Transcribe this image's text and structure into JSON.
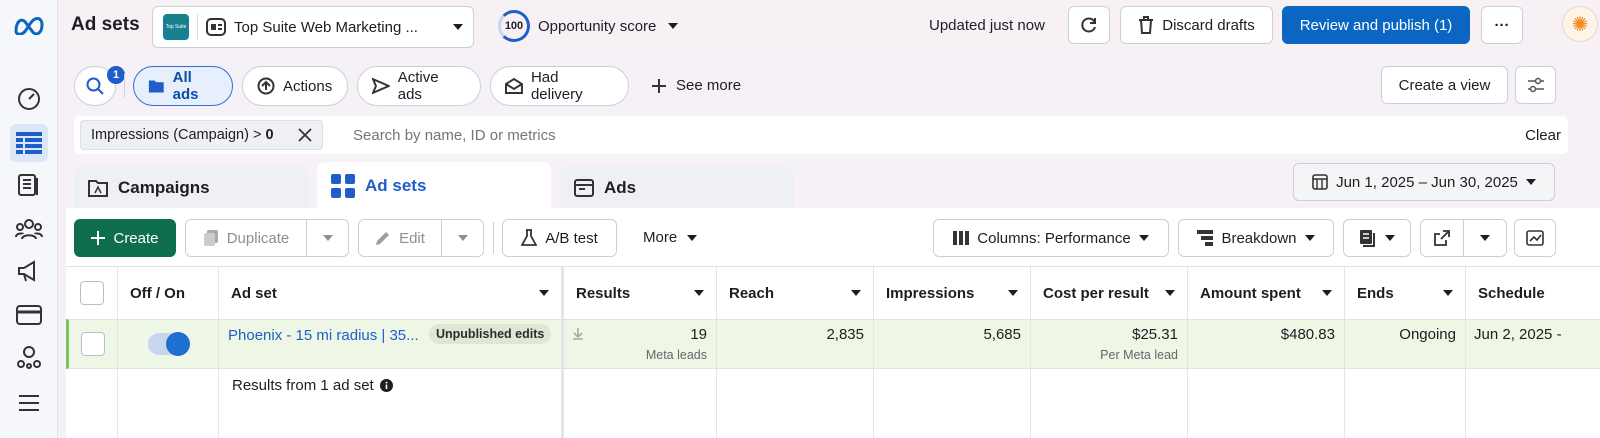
{
  "header": {
    "title": "Ad sets",
    "account_name": "Top Suite Web Marketing ...",
    "account_logo_text": "Top Suite",
    "opportunity_score_value": "100",
    "opportunity_score_label": "Opportunity score",
    "updated_text": "Updated just now",
    "discard_label": "Discard drafts",
    "review_label": "Review and publish (1)",
    "more_label": "···"
  },
  "filters": {
    "search_badge": "1",
    "chips": [
      "All ads",
      "Actions",
      "Active ads",
      "Had delivery",
      "See more"
    ],
    "create_view_label": "Create a view",
    "active_filter_name": "Impressions (Campaign) >",
    "active_filter_value": "0",
    "search_placeholder": "Search by name, ID or metrics",
    "clear_label": "Clear"
  },
  "tabs": [
    "Campaigns",
    "Ad sets",
    "Ads"
  ],
  "date_range": "Jun 1, 2025 – Jun 30, 2025",
  "toolbar": {
    "create": "Create",
    "duplicate": "Duplicate",
    "edit": "Edit",
    "ab_test": "A/B test",
    "more": "More",
    "columns": "Columns: Performance",
    "breakdown": "Breakdown"
  },
  "table": {
    "headers": [
      "Off / On",
      "Ad set",
      "Results",
      "Reach",
      "Impressions",
      "Cost per result",
      "Amount spent",
      "Ends",
      "Schedule"
    ],
    "row": {
      "name": "Phoenix - 15 mi radius | 35...",
      "badge": "Unpublished edits",
      "results": "19",
      "results_sub": "Meta leads",
      "reach": "2,835",
      "impressions": "5,685",
      "cost_per_result": "$25.31",
      "cost_sub": "Per Meta lead",
      "amount_spent": "$480.83",
      "ends": "Ongoing",
      "schedule": "Jun 2, 2025 -"
    },
    "summary": "Results from 1 ad set"
  },
  "colors": {
    "accent": "#0a66c2",
    "create_green": "#0f6e4e",
    "row_highlight": "#eef7e6"
  }
}
